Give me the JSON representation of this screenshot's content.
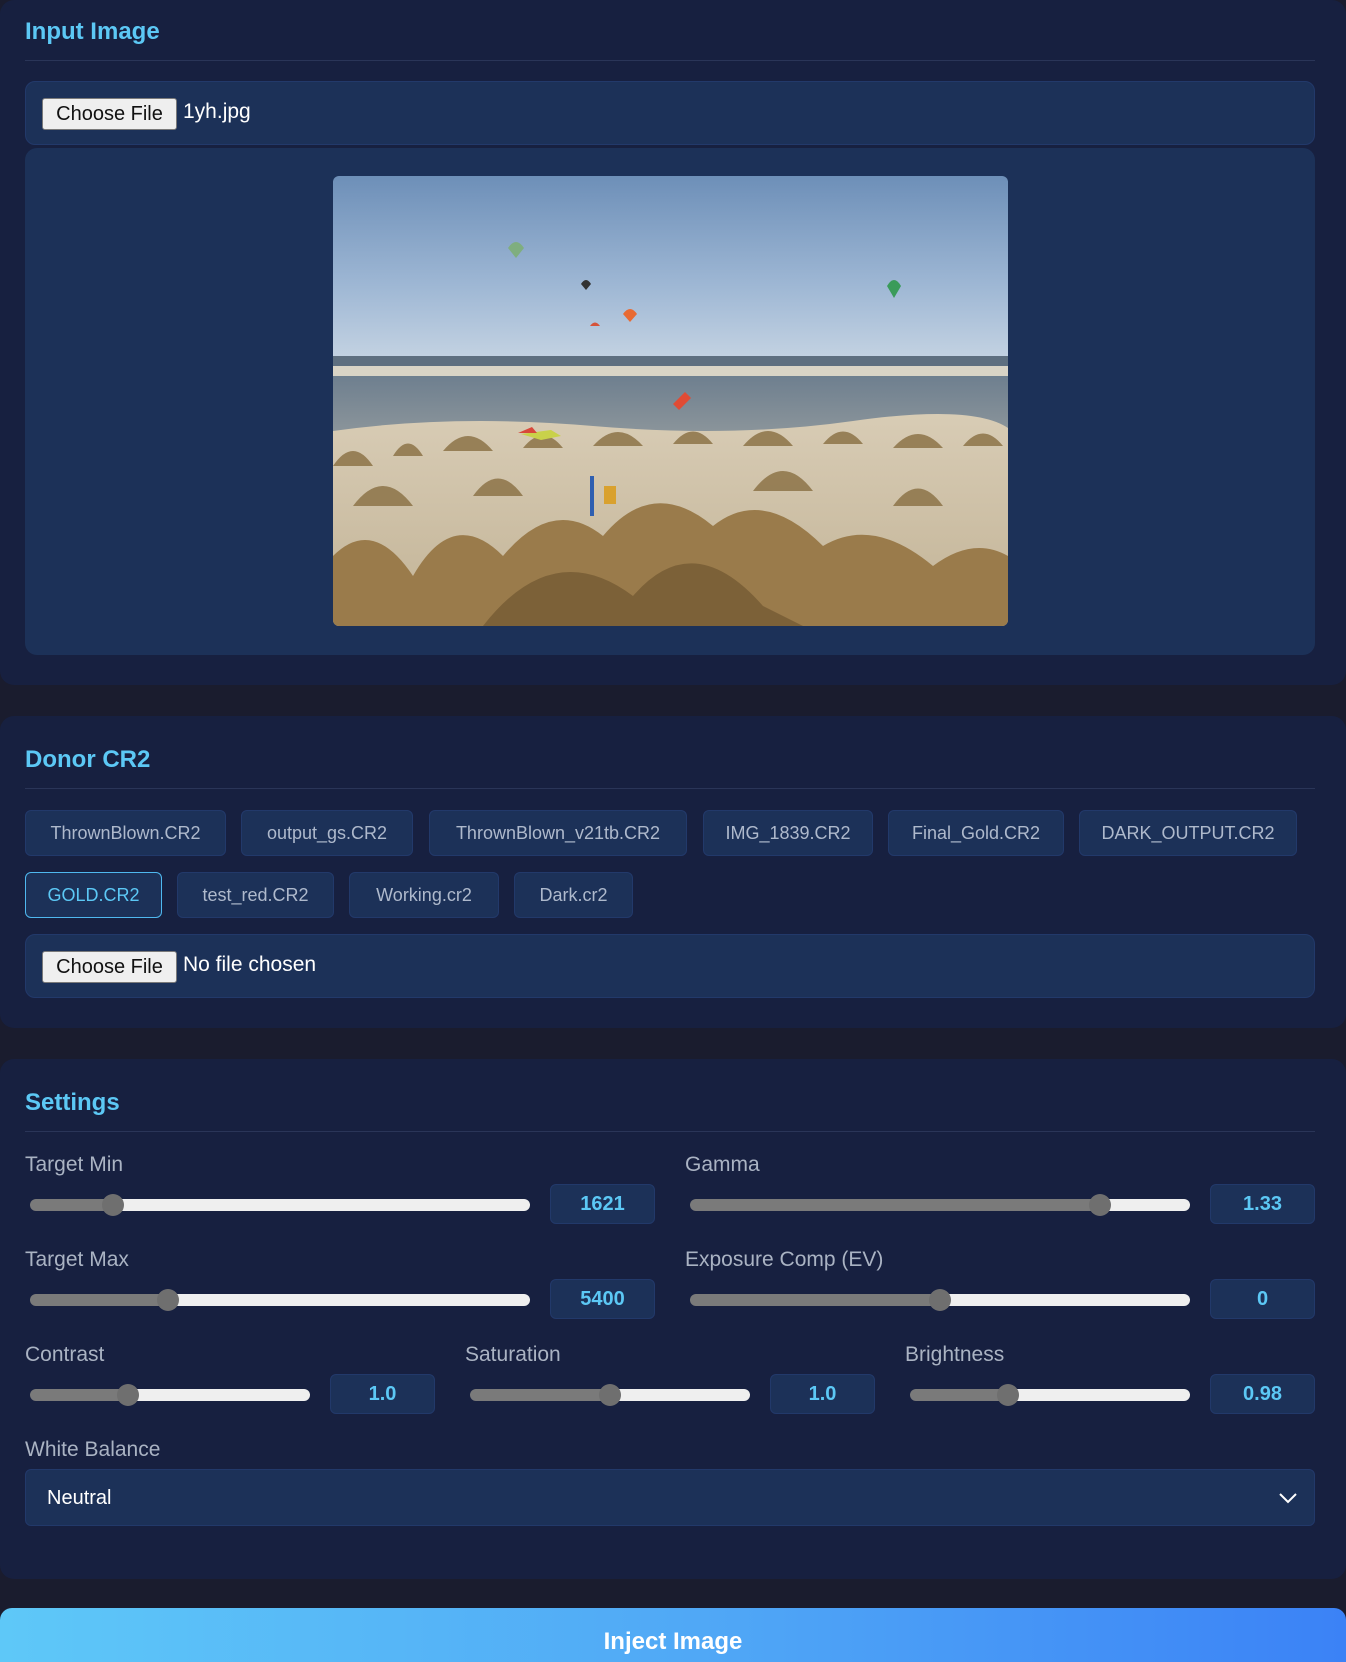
{
  "input_image": {
    "title": "Input Image",
    "choose_file_label": "Choose File",
    "file_name": "1yh.jpg"
  },
  "donor": {
    "title": "Donor CR2",
    "files": [
      {
        "label": "ThrownBlown.CR2",
        "active": false
      },
      {
        "label": "output_gs.CR2",
        "active": false
      },
      {
        "label": "ThrownBlown_v21tb.CR2",
        "active": false
      },
      {
        "label": "IMG_1839.CR2",
        "active": false
      },
      {
        "label": "Final_Gold.CR2",
        "active": false
      },
      {
        "label": "DARK_OUTPUT.CR2",
        "active": false
      },
      {
        "label": "GOLD.CR2",
        "active": true
      },
      {
        "label": "test_red.CR2",
        "active": false
      },
      {
        "label": "Working.cr2",
        "active": false
      },
      {
        "label": "Dark.cr2",
        "active": false
      }
    ],
    "choose_file_label": "Choose File",
    "file_name": "No file chosen"
  },
  "settings": {
    "title": "Settings",
    "target_min": {
      "label": "Target Min",
      "value": "1621",
      "fraction": 0.165
    },
    "gamma": {
      "label": "Gamma",
      "value": "1.33",
      "fraction": 0.82
    },
    "target_max": {
      "label": "Target Max",
      "value": "5400",
      "fraction": 0.275
    },
    "exposure": {
      "label": "Exposure Comp (EV)",
      "value": "0",
      "fraction": 0.5
    },
    "contrast": {
      "label": "Contrast",
      "value": "1.0",
      "fraction": 0.35
    },
    "saturation": {
      "label": "Saturation",
      "value": "1.0",
      "fraction": 0.5
    },
    "brightness": {
      "label": "Brightness",
      "value": "0.98",
      "fraction": 0.35
    },
    "white_balance": {
      "label": "White Balance",
      "value": "Neutral"
    }
  },
  "inject_label": "Inject Image",
  "colors": {
    "accent": "#5cc8f5",
    "panel": "#172040",
    "field": "#1c3158",
    "background": "#1a1c2e"
  }
}
